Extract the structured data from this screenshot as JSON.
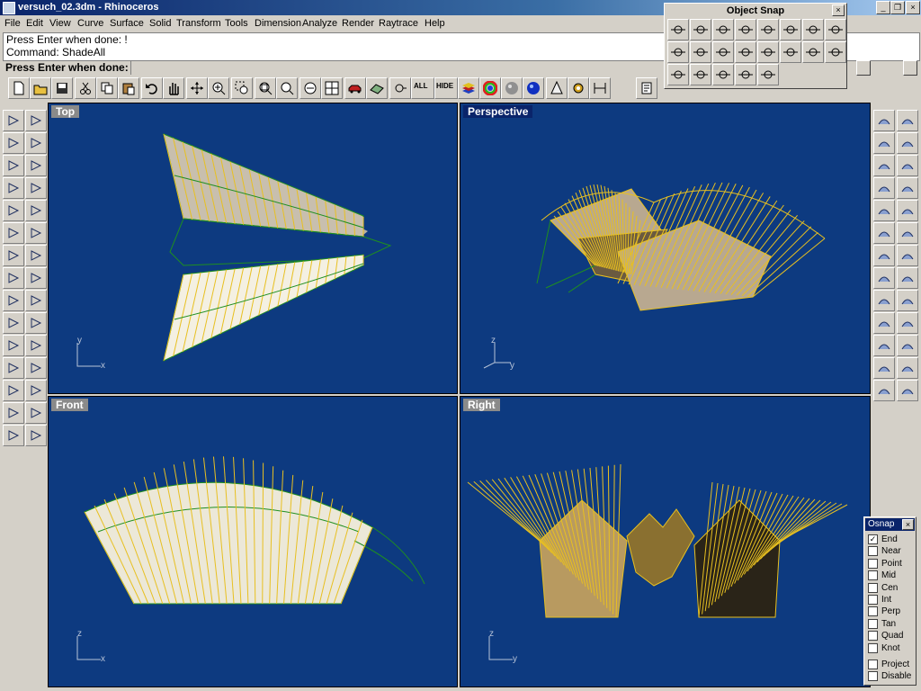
{
  "window": {
    "title": "versuch_02.3dm - Rhinoceros"
  },
  "menu": [
    "File",
    "Edit",
    "View",
    "Curve",
    "Surface",
    "Solid",
    "Transform",
    "Tools",
    "Dimension",
    "Analyze",
    "Render",
    "Raytrace",
    "Help"
  ],
  "command_history": [
    "Press Enter when done: !",
    "Command: ShadeAll"
  ],
  "prompt": {
    "label": "Press Enter when done:",
    "value": ""
  },
  "toolbar": {
    "icons": [
      "new-file",
      "open-file",
      "save",
      "cut",
      "copy",
      "paste",
      "undo",
      "pan",
      "rotate-view",
      "zoom-dynamic",
      "zoom-window",
      "zoom-extents",
      "zoom-selected",
      "undo-view",
      "four-viewports",
      "car-named-view",
      "camera-view",
      "select-point",
      "select-all",
      "hide",
      "layers",
      "color-wheel",
      "render-sphere",
      "render-blue-sphere",
      "light",
      "gear-options",
      "dimension",
      "properties"
    ],
    "select_all_text": "ALL",
    "hide_text": "HIDE"
  },
  "viewports": [
    {
      "id": "top",
      "label": "Top",
      "active": false,
      "axis_h": "x",
      "axis_v": "y"
    },
    {
      "id": "perspective",
      "label": "Perspective",
      "active": true,
      "axis_h": "y",
      "axis_v": "z"
    },
    {
      "id": "front",
      "label": "Front",
      "active": false,
      "axis_h": "x",
      "axis_v": "z"
    },
    {
      "id": "right",
      "label": "Right",
      "active": false,
      "axis_h": "y",
      "axis_v": "z"
    }
  ],
  "object_snap_toolbar": {
    "title": "Object Snap",
    "close": "×"
  },
  "osnap_panel": {
    "title": "Osnap",
    "close": "×",
    "options": [
      {
        "label": "End",
        "checked": true
      },
      {
        "label": "Near",
        "checked": false
      },
      {
        "label": "Point",
        "checked": false
      },
      {
        "label": "Mid",
        "checked": false
      },
      {
        "label": "Cen",
        "checked": false
      },
      {
        "label": "Int",
        "checked": false
      },
      {
        "label": "Perp",
        "checked": false
      },
      {
        "label": "Tan",
        "checked": false
      },
      {
        "label": "Quad",
        "checked": false
      },
      {
        "label": "Knot",
        "checked": false
      }
    ],
    "extra": [
      {
        "label": "Project",
        "checked": false
      },
      {
        "label": "Disable",
        "checked": false
      }
    ]
  },
  "colors": {
    "viewport_bg": "#0d3a80",
    "wire_yellow": "#e8c020",
    "wire_green": "#1f8f1f",
    "surface_light": "#ece8d8"
  }
}
